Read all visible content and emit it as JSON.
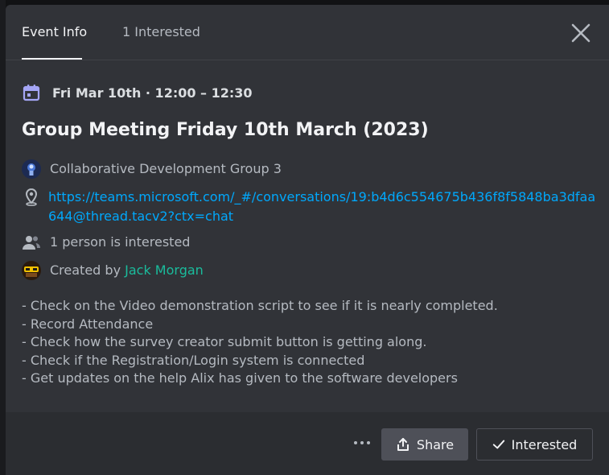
{
  "tabs": {
    "event_info": "Event Info",
    "interested": "1 Interested"
  },
  "event": {
    "datetime": "Fri Mar 10th · 12:00 – 12:30",
    "title": "Group Meeting Friday 10th March (2023)",
    "group": "Collaborative Development Group 3",
    "link": "https://teams.microsoft.com/_#/conversations/19:b4d6c554675b436f8f5848ba3dfaa644@thread.tacv2?ctx=chat",
    "interested_count": "1 person is interested",
    "created_by_prefix": "Created by ",
    "creator": "Jack Morgan"
  },
  "description": [
    "- Check on the Video demonstration script to see if it is nearly completed.",
    "- Record Attendance",
    "- Check how the survey creator submit button is getting along.",
    "- Check if the Registration/Login system is connected",
    "- Get updates on the help Alix has given to the software developers"
  ],
  "footer": {
    "share_label": "Share",
    "interested_label": "Interested"
  },
  "colors": {
    "accent_link": "#00a8fc",
    "creator_name": "#1abc9c",
    "calendar_icon": "#a5a6f6"
  },
  "icons": {
    "close": "close-icon",
    "calendar": "calendar-icon",
    "location": "location-icon",
    "people": "people-icon",
    "share": "share-icon",
    "check": "check-icon",
    "more": "more-icon"
  }
}
